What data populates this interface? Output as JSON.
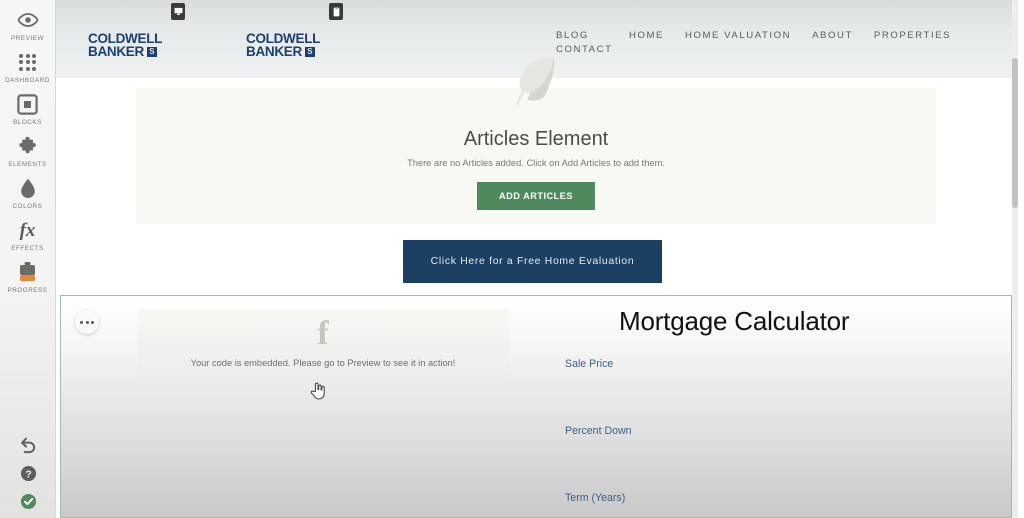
{
  "sidebar": {
    "items": [
      {
        "label": "PREVIEW",
        "icon": "eye-icon"
      },
      {
        "label": "DASHBOARD",
        "icon": "grid-dots-icon"
      },
      {
        "label": "BLOCKS",
        "icon": "square-nested-icon"
      },
      {
        "label": "ELEMENTS",
        "icon": "puzzle-piece-icon"
      },
      {
        "label": "COLORS",
        "icon": "droplet-icon"
      },
      {
        "label": "EFFECTS",
        "icon": "fx-icon"
      },
      {
        "label": "PROGRESS",
        "icon": "battery-progress-icon"
      }
    ],
    "bottom": [
      {
        "icon": "undo-icon"
      },
      {
        "icon": "help-circle-icon"
      },
      {
        "icon": "check-circle-icon"
      }
    ],
    "accent_orange": "#e08a40",
    "accent_green": "#4f8a5f"
  },
  "site": {
    "device_badges": [
      {
        "name": "desktop-view",
        "icon": "monitor-icon"
      },
      {
        "name": "mobile-view",
        "icon": "phone-icon"
      }
    ],
    "logos": [
      {
        "line1": "COLDWELL",
        "line2": "BANKER",
        "mark": "⧉"
      },
      {
        "line1": "COLDWELL",
        "line2": "BANKER",
        "mark": "⧉"
      }
    ],
    "nav": [
      "HOME",
      "HOME VALUATION",
      "ABOUT",
      "PROPERTIES",
      "BLOG",
      "CONTACT"
    ],
    "brand_navy": "#1d3f6e"
  },
  "articles": {
    "title": "Articles Element",
    "subtitle": "There are no Articles added. Click on Add Articles to add them.",
    "button_label": "ADD ARTICLES",
    "icon": "feather-icon",
    "panel_bg": "#f9f9f3",
    "button_bg": "#4f8a5f"
  },
  "cta": {
    "label": "Click Here for a Free Home Evaluation",
    "bg": "#1c3f64"
  },
  "embed": {
    "icon": "facebook-f-icon",
    "message": "Your code is embedded. Please go to Preview to see it in action!",
    "options_icon": "ellipsis-icon"
  },
  "mortgage": {
    "title": "Mortgage Calculator",
    "fields": [
      {
        "label": "Sale Price"
      },
      {
        "label": "Percent Down"
      },
      {
        "label": "Term (Years)"
      }
    ],
    "label_color": "#3f5f80"
  },
  "selection": {
    "border_color": "#9fbcae"
  },
  "cursor": {
    "type": "pointing-hand-cursor"
  }
}
